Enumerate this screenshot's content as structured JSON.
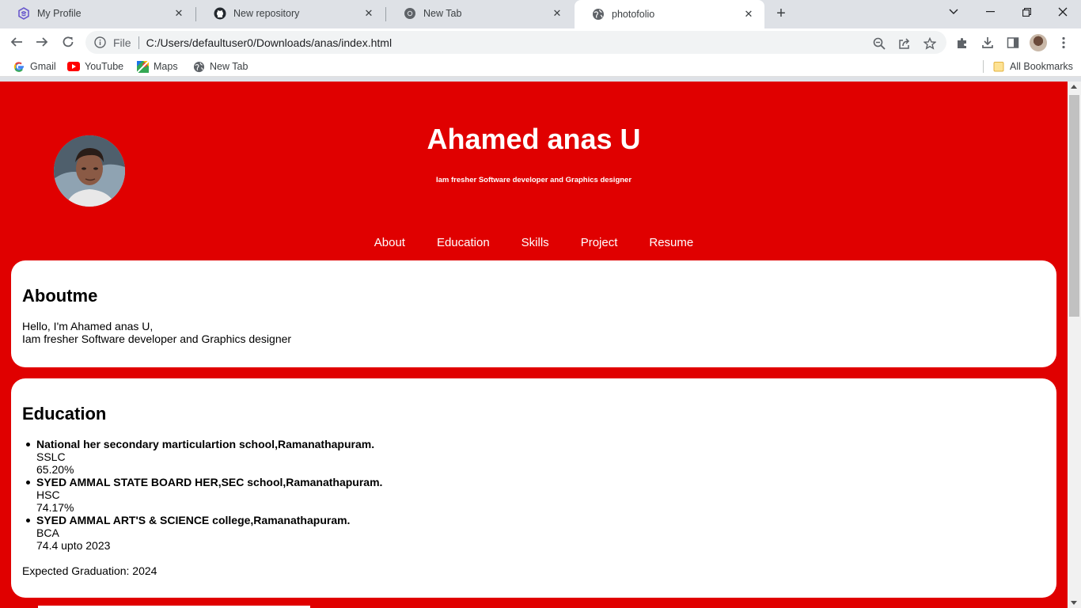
{
  "browser": {
    "tabs": [
      {
        "title": "My Profile",
        "icon": "profile-site-icon"
      },
      {
        "title": "New repository",
        "icon": "github-icon"
      },
      {
        "title": "New Tab",
        "icon": "chrome-icon"
      },
      {
        "title": "photofolio",
        "icon": "globe-icon",
        "active": true
      }
    ],
    "address": {
      "scheme_label": "File",
      "url": "C:/Users/defaultuser0/Downloads/anas/index.html"
    },
    "bookmarks": [
      {
        "label": "Gmail",
        "icon": "google-icon"
      },
      {
        "label": "YouTube",
        "icon": "youtube-icon"
      },
      {
        "label": "Maps",
        "icon": "maps-icon"
      },
      {
        "label": "New Tab",
        "icon": "globe-icon"
      }
    ],
    "all_bookmarks_label": "All Bookmarks"
  },
  "page": {
    "colors": {
      "background": "#e00000",
      "card": "#ffffff",
      "text": "#ffffff"
    },
    "header": {
      "name": "Ahamed anas U",
      "tagline": "Iam fresher Software developer and Graphics designer"
    },
    "nav": [
      "About",
      "Education",
      "Skills",
      "Project",
      "Resume"
    ],
    "about": {
      "heading": "Aboutme",
      "line1": "Hello, I'm Ahamed anas U,",
      "line2": "Iam fresher Software developer and Graphics designer"
    },
    "education": {
      "heading": "Education",
      "items": [
        {
          "school": "National her secondary marticulartion school,Ramanathapuram.",
          "level": "SSLC",
          "score": "65.20%"
        },
        {
          "school": "SYED AMMAL STATE BOARD HER,SEC school,Ramanathapuram.",
          "level": "HSC",
          "score": "74.17%"
        },
        {
          "school": "SYED AMMAL ART'S & SCIENCE college,Ramanathapuram.",
          "level": "BCA",
          "score": "74.4 upto 2023"
        }
      ],
      "expected": "Expected Graduation: 2024"
    }
  }
}
